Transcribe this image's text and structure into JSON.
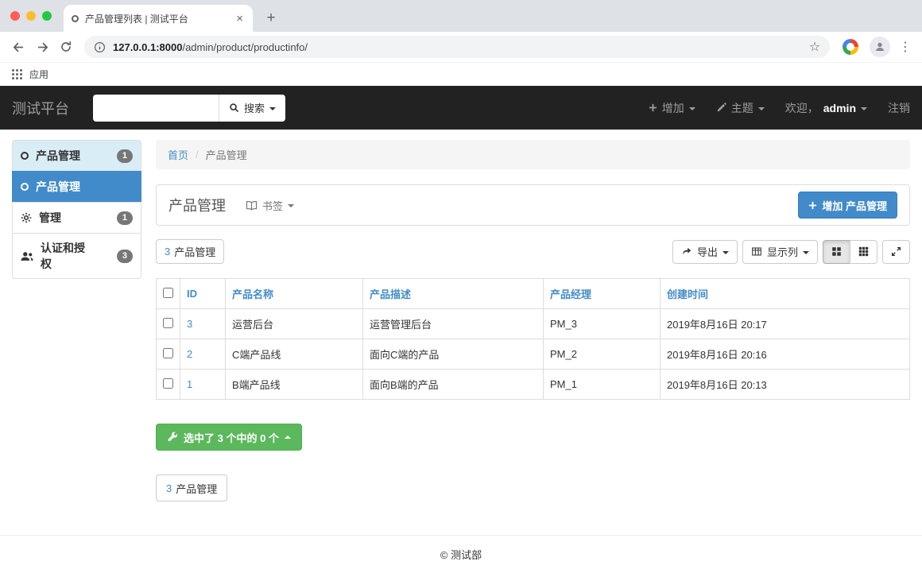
{
  "colors": {
    "accent_blue": "#428bca",
    "success_green": "#5cb85c",
    "navbar_bg": "#222222",
    "sidebar_highlight": "#d9edf7"
  },
  "glyphs": {
    "close": "×",
    "new_tab": "+",
    "star": "☆",
    "menu_dots": "⋮",
    "separator": "/"
  },
  "browser": {
    "tab_title": "产品管理列表 | 测试平台",
    "url_domain": "127.0.0.1:8000",
    "url_path": "/admin/product/productinfo/",
    "bookmarks_label": "应用"
  },
  "navbar": {
    "brand": "测试平台",
    "search_button": "搜索",
    "menu_add": "增加",
    "menu_theme": "主题",
    "welcome_prefix": "欢迎，",
    "username": "admin",
    "logout": "注销"
  },
  "sidebar": {
    "items": [
      {
        "label": "产品管理",
        "badge": "1"
      },
      {
        "label": "产品管理"
      },
      {
        "label": "管理",
        "badge": "1"
      },
      {
        "label": "认证和授权",
        "badge": "3"
      }
    ]
  },
  "breadcrumb": {
    "home": "首页",
    "current": "产品管理"
  },
  "panel": {
    "title": "产品管理",
    "bookmark": "书签",
    "add_button": "增加 产品管理"
  },
  "toolbar": {
    "count_number": "3",
    "count_label": "产品管理",
    "export": "导出",
    "columns": "显示列"
  },
  "table": {
    "headers": {
      "id": "ID",
      "name": "产品名称",
      "desc": "产品描述",
      "pm": "产品经理",
      "created": "创建时间"
    },
    "rows": [
      {
        "id": "3",
        "name": "运营后台",
        "desc": "运营管理后台",
        "pm": "PM_3",
        "created": "2019年8月16日 20:17"
      },
      {
        "id": "2",
        "name": "C端产品线",
        "desc": "面向C端的产品",
        "pm": "PM_2",
        "created": "2019年8月16日 20:16"
      },
      {
        "id": "1",
        "name": "B端产品线",
        "desc": "面向B端的产品",
        "pm": "PM_1",
        "created": "2019年8月16日 20:13"
      }
    ]
  },
  "bulk": {
    "selected_button": "选中了 3 个中的 0 个"
  },
  "bottom_count": {
    "number": "3",
    "label": "产品管理"
  },
  "footer": {
    "copyright": "© 测试部"
  }
}
